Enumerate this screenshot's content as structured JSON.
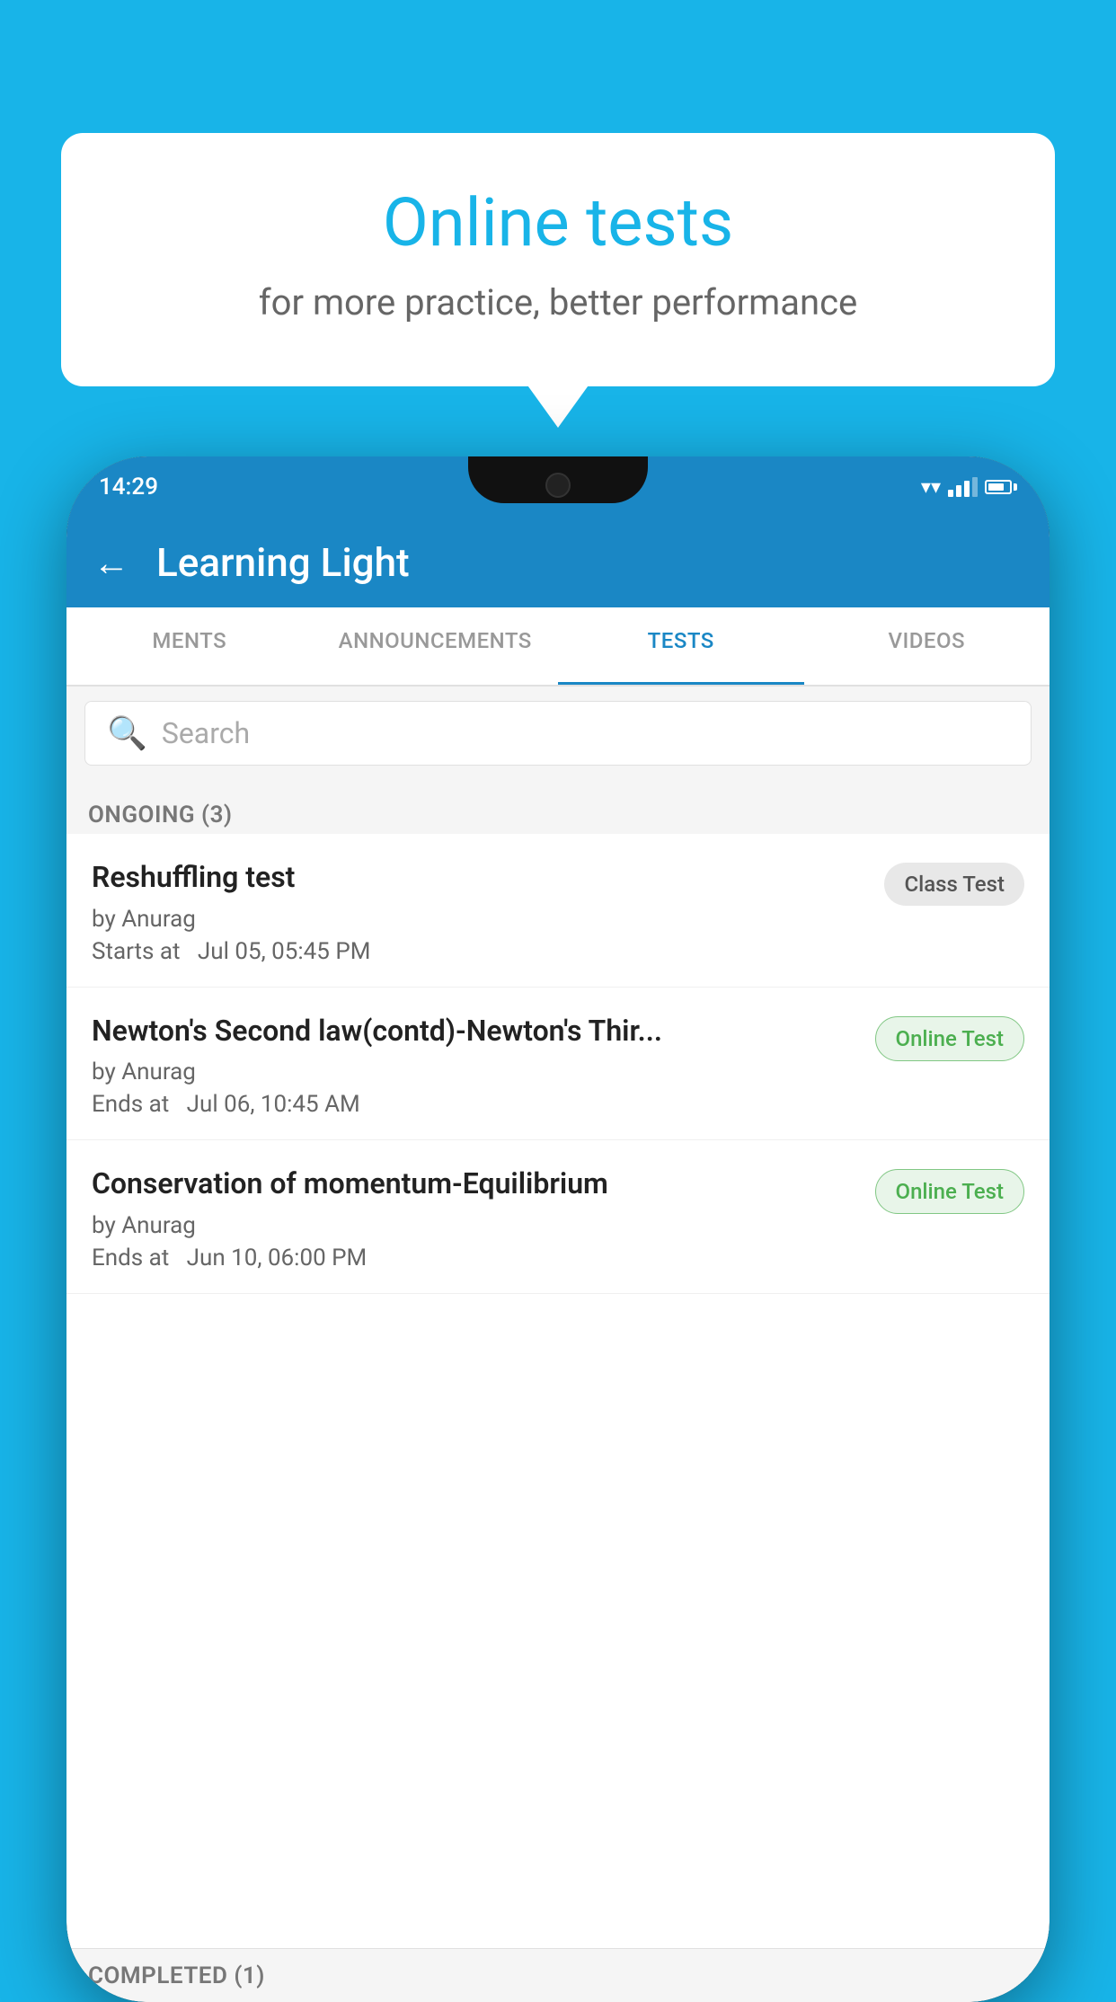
{
  "background_color": "#18B4E8",
  "speech_bubble": {
    "title": "Online tests",
    "subtitle": "for more practice, better performance"
  },
  "phone": {
    "status_bar": {
      "time": "14:29"
    },
    "app_bar": {
      "title": "Learning Light",
      "back_label": "←"
    },
    "tabs": [
      {
        "id": "ments",
        "label": "MENTS",
        "active": false
      },
      {
        "id": "announcements",
        "label": "ANNOUNCEMENTS",
        "active": false
      },
      {
        "id": "tests",
        "label": "TESTS",
        "active": true
      },
      {
        "id": "videos",
        "label": "VIDEOS",
        "active": false
      }
    ],
    "search": {
      "placeholder": "Search"
    },
    "ongoing_section": {
      "title": "ONGOING (3)"
    },
    "tests": [
      {
        "id": "test1",
        "title": "Reshuffling test",
        "author": "by Anurag",
        "time_label": "Starts at",
        "time": "Jul 05, 05:45 PM",
        "badge": "Class Test",
        "badge_type": "class"
      },
      {
        "id": "test2",
        "title": "Newton's Second law(contd)-Newton's Thir...",
        "author": "by Anurag",
        "time_label": "Ends at",
        "time": "Jul 06, 10:45 AM",
        "badge": "Online Test",
        "badge_type": "online"
      },
      {
        "id": "test3",
        "title": "Conservation of momentum-Equilibrium",
        "author": "by Anurag",
        "time_label": "Ends at",
        "time": "Jun 10, 06:00 PM",
        "badge": "Online Test",
        "badge_type": "online"
      }
    ],
    "completed_section": {
      "title": "COMPLETED (1)"
    }
  }
}
